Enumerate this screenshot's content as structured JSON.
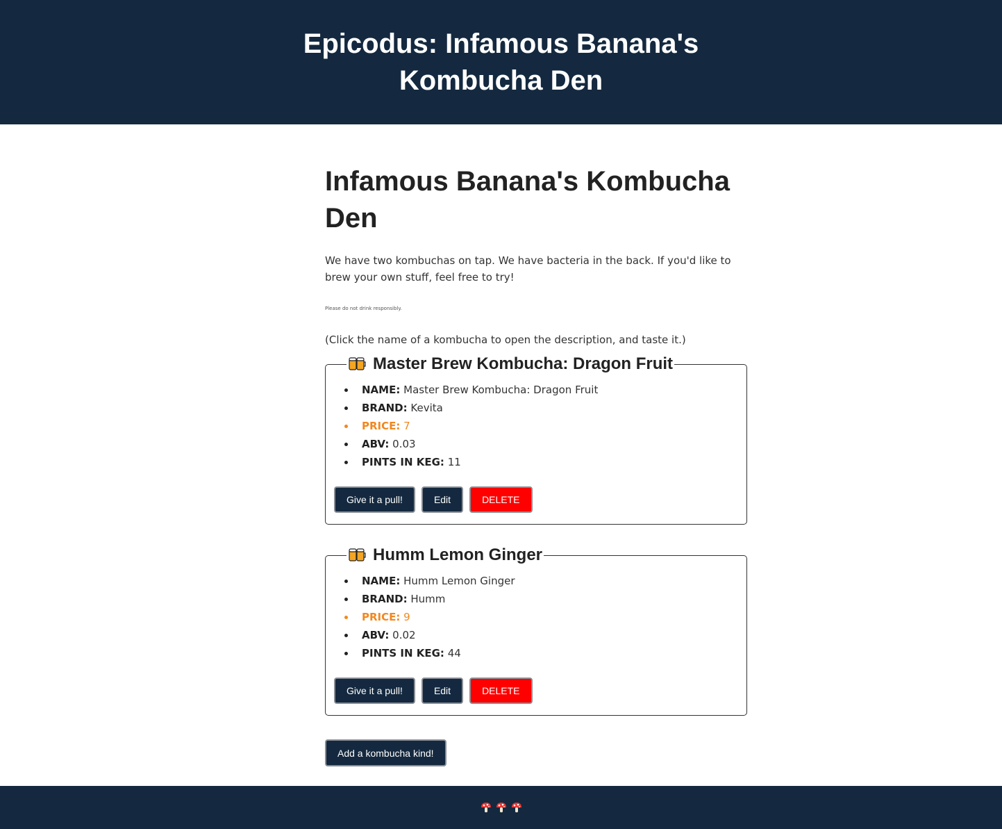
{
  "header": {
    "title": "Epicodus: Infamous Banana's Kombucha Den"
  },
  "main": {
    "title": "Infamous Banana's Kombucha Den",
    "intro": "We have two kombuchas on tap. We have bacteria in the back. If you'd like to brew your own stuff, feel free to try!",
    "disclaimer": "Please do not drink responsibly.",
    "instruction": "(Click the name of a kombucha to open the description, and taste it.)",
    "add_button": "Add a kombucha kind!"
  },
  "labels": {
    "name": "NAME:",
    "brand": "BRAND:",
    "price": "PRICE:",
    "abv": "ABV:",
    "pints": "PINTS IN KEG:",
    "pull_button": "Give it a pull!",
    "edit_button": "Edit",
    "delete_button": "DELETE"
  },
  "kegs": [
    {
      "title": "Master Brew Kombucha: Dragon Fruit",
      "name": "Master Brew Kombucha: Dragon Fruit",
      "brand": "Kevita",
      "price": "7",
      "abv": "0.03",
      "pints": "11",
      "icon": "beer-mugs-icon"
    },
    {
      "title": "Humm Lemon Ginger",
      "name": "Humm Lemon Ginger",
      "brand": "Humm",
      "price": "9",
      "abv": "0.02",
      "pints": "44",
      "icon": "beer-mugs-icon"
    }
  ],
  "footer": {
    "icons": [
      "mushroom-icon",
      "mushroom-icon",
      "mushroom-icon"
    ]
  },
  "colors": {
    "navy": "#14293f",
    "delete_red": "#ff0000",
    "price_orange": "#f2871f"
  }
}
